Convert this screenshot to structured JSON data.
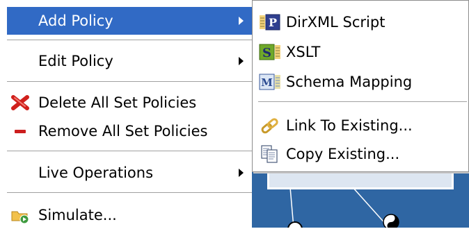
{
  "main_menu": {
    "add_policy": "Add Policy",
    "edit_policy": "Edit Policy",
    "delete_all": "Delete All Set Policies",
    "remove_all": "Remove All Set Policies",
    "live_operations": "Live Operations",
    "simulate": "Simulate..."
  },
  "sub_menu": {
    "dirxml_script": "DirXML Script",
    "xslt": "XSLT",
    "schema_mapping": "Schema Mapping",
    "link_existing": "Link To Existing...",
    "copy_existing": "Copy Existing..."
  },
  "icons": {
    "dirxml_script": "dirxml-script-icon",
    "xslt": "xslt-icon",
    "schema_mapping": "schema-mapping-icon",
    "link_existing": "chain-link-icon",
    "copy_existing": "copy-documents-icon",
    "delete_all": "red-x-icon",
    "remove_all": "red-minus-icon",
    "simulate": "simulate-icon"
  },
  "colors": {
    "highlight": "#316ac5",
    "canvas": "#2f66a3"
  }
}
